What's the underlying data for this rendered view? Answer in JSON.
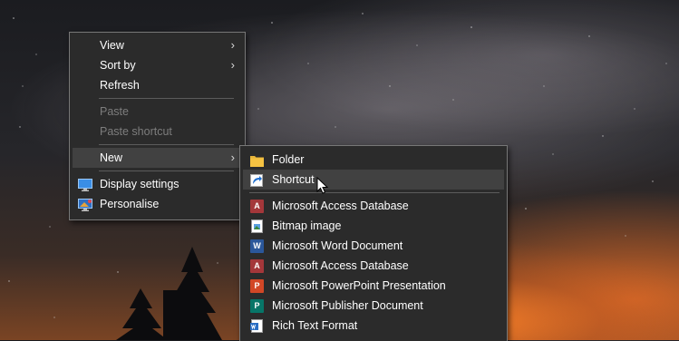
{
  "desktop": {
    "accent": "#2b2b2b",
    "wallpaper_colors": [
      "#1b1c20",
      "#7a4424",
      "#ff8228"
    ]
  },
  "context_menu": {
    "items": [
      {
        "label": "View",
        "has_submenu": true
      },
      {
        "label": "Sort by",
        "has_submenu": true
      },
      {
        "label": "Refresh"
      },
      {
        "label": "Paste",
        "disabled": true
      },
      {
        "label": "Paste shortcut",
        "disabled": true
      },
      {
        "label": "New",
        "has_submenu": true,
        "highlighted": true
      },
      {
        "label": "Display settings",
        "icon": "monitor-icon"
      },
      {
        "label": "Personalise",
        "icon": "personalise-icon"
      }
    ],
    "chevron": "›"
  },
  "new_submenu": {
    "items": [
      {
        "label": "Folder",
        "icon": "folder-icon"
      },
      {
        "label": "Shortcut",
        "icon": "shortcut-icon",
        "highlighted": true
      },
      {
        "label": "Microsoft Access Database",
        "icon": "access-icon"
      },
      {
        "label": "Bitmap image",
        "icon": "bitmap-icon"
      },
      {
        "label": "Microsoft Word Document",
        "icon": "word-icon"
      },
      {
        "label": "Microsoft Access Database",
        "icon": "access-icon"
      },
      {
        "label": "Microsoft PowerPoint Presentation",
        "icon": "powerpoint-icon"
      },
      {
        "label": "Microsoft Publisher Document",
        "icon": "publisher-icon"
      },
      {
        "label": "Rich Text Format",
        "icon": "wordpad-icon"
      }
    ],
    "icon_colors": {
      "access": "#a4373a",
      "word": "#2b579a",
      "powerpoint": "#d24726",
      "publisher": "#077568",
      "folder": "#f5c242"
    }
  }
}
